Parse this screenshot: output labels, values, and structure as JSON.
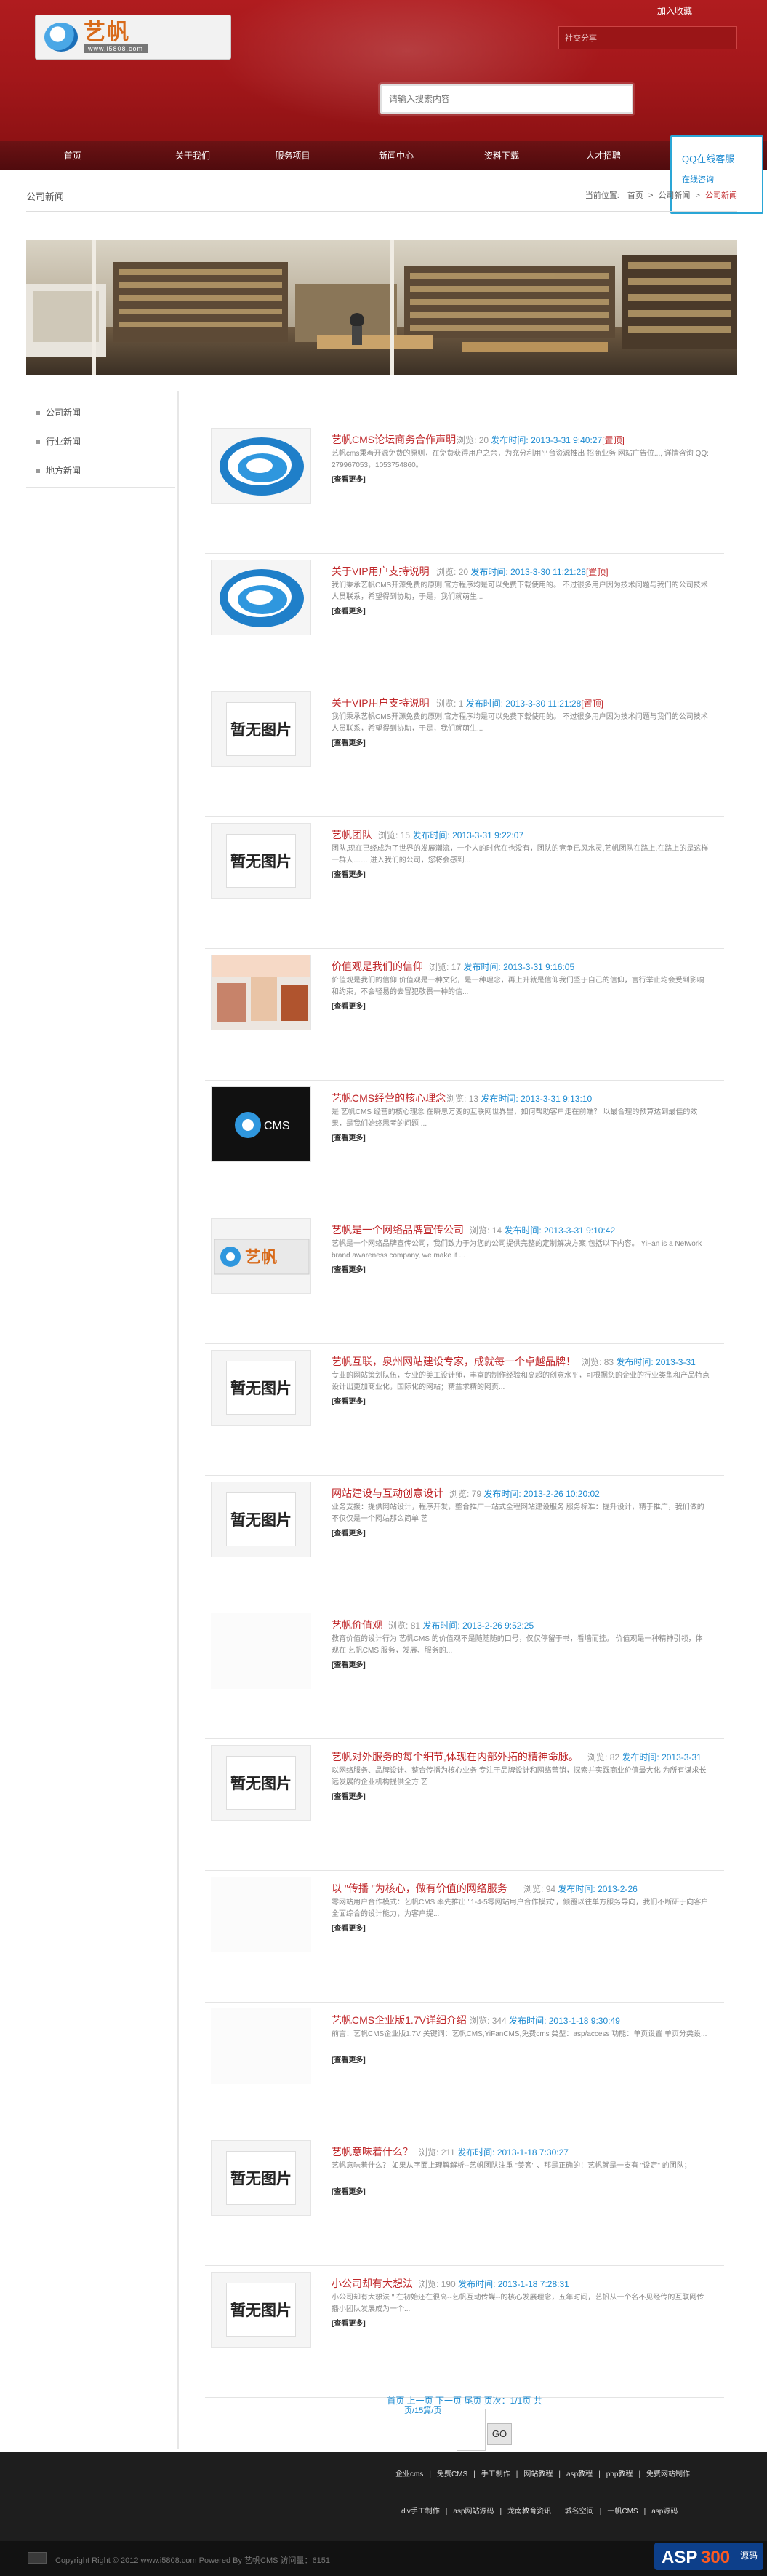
{
  "header": {
    "logo_cn": "艺帆",
    "logo_en": "www.i5808.com",
    "favorite": "加入收藏",
    "share": "社交分享",
    "search_placeholder": "请输入搜索内容"
  },
  "nav": [
    "首页",
    "关于我们",
    "服务项目",
    "新闻中心",
    "资料下载",
    "人才招聘"
  ],
  "qq": {
    "title": "QQ在线客服",
    "sub": "在线咨询"
  },
  "page": {
    "section": "公司新闻",
    "crumb_label": "当前位置:",
    "crumbs": [
      "首页",
      "公司新闻",
      "公司新闻"
    ]
  },
  "sidebar": [
    "公司新闻",
    "行业新闻",
    "地方新闻"
  ],
  "list": [
    {
      "title": "艺帆CMS论坛商务合作声明",
      "views": "20",
      "time": "2013-3-31 9:40:27",
      "top": "[置顶]",
      "desc": "艺帆cms秉着开源免费的原则，在免费获得用户之余，为充分利用平台资源推出 招商业务 网站广告位..., 详情咨询 QQ: 279967053，1053754860。",
      "thumb": "logo"
    },
    {
      "title": "关于VIP用户支持说明",
      "views": "20",
      "time": "2013-3-30 11:21:28",
      "top": "[置顶]",
      "desc": "我们秉承艺帆CMS开源免费的原则,官方程序均是可以免费下载使用的。 不过很多用户因为技术问题与我们的公司技术人员联系，希望得到协助，于是，我们就萌生...",
      "thumb": "logo"
    },
    {
      "title": "关于VIP用户支持说明",
      "views": "1",
      "time": "2013-3-30 11:21:28",
      "top": "[置顶]",
      "desc": "我们秉承艺帆CMS开源免费的原则,官方程序均是可以免费下载使用的。 不过很多用户因为技术问题与我们的公司技术人员联系，希望得到协助，于是，我们就萌生...",
      "thumb": "none"
    },
    {
      "title": "艺帆团队",
      "views": "15",
      "time": "2013-3-31 9:22:07",
      "top": "",
      "desc": "团队,现在已经成为了世界的发展潮流，一个人的时代在也没有，团队的竞争已风水灵,艺帆团队在路上,在路上的是这样一群人…… 进入我们的公司，您将会感到...",
      "thumb": "none"
    },
    {
      "title": "价值观是我们的信仰",
      "views": "17",
      "time": "2013-3-31 9:16:05",
      "top": "",
      "desc": "价值观是我们的信仰 价值观是一种文化，是一种理念，再上升就是信仰我们坚于自己的信仰，言行举止均会受到影响和约束，不会轻易的去冒犯敬畏一种的信...",
      "thumb": "photo"
    },
    {
      "title": "艺帆CMS经营的核心理念",
      "views": "13",
      "time": "2013-3-31 9:13:10",
      "top": "",
      "desc": "是 艺帆CMS 经营的核心理念 在瞬息万变的互联网世界里，如何帮助客户走在前端？ 以最合理的预算达到最佳的效果，是我们始终思考的问题 ...",
      "thumb": "dark"
    },
    {
      "title": "艺帆是一个网络品牌宣传公司",
      "views": "14",
      "time": "2013-3-31 9:10:42",
      "top": "",
      "desc": "艺帆是一个网络品牌宣传公司，我们致力于为您的公司提供完整的定制解决方案,包括以下内容。 YiFan is a Network brand awareness company, we make it ...",
      "thumb": "brand"
    },
    {
      "title": "艺帆互联，泉州网站建设专家，成就每一个卓越品牌！",
      "views": "83",
      "time": "2013-3-31",
      "top": "",
      "desc": "专业的网站策划队伍，专业的美工设计师，丰富的制作经验和高超的创意水平，可根据您的企业的行业类型和产品特点设计出更加商业化，国际化的网站；精益求精的网页...",
      "thumb": "none"
    },
    {
      "title": "网站建设与互动创意设计",
      "views": "79",
      "time": "2013-2-26 10:20:02",
      "top": "",
      "desc": "业务支援：提供网站设计，程序开发，整合推广一站式全程网站建设服务 服务标准：提升设计，精于推广，我们做的不仅仅是一个网站那么简单 艺",
      "thumb": "none"
    },
    {
      "title": "艺帆价值观",
      "views": "81",
      "time": "2013-2-26 9:52:25",
      "top": "",
      "desc": "教育价值的设计行为 艺帆CMS 的价值观不是随随随的口号，仅仅停留于书，看墙而挂。 价值观是一种精神引领，体现在 艺帆CMS 服务，发展、服务的...",
      "thumb": "grey"
    },
    {
      "title": "艺帆对外服务的每个细节,体现在内部外拓的精神命脉。",
      "views": "82",
      "time": "2013-3-31",
      "top": "",
      "desc": "以网络服务、品牌设计、整合传播为核心业务 专注于品牌设计和网络营销，探索并实践商业价值最大化 为所有谋求长远发展的企业机构提供全方 艺",
      "thumb": "none"
    },
    {
      "title": "以 \"传播 \"为核心，做有价值的网络服务",
      "views": "94",
      "time": "2013-2-26",
      "top": "",
      "desc": "零网站用户合作模式：艺帆CMS 率先推出 \"1-4-5零网站用户合作模式\"，倾覆以往单方服务导向，我们不断研于向客户全面综合的设计能力，为客户提...",
      "thumb": "blank"
    },
    {
      "title": "艺帆CMS企业版1.7V详细介绍",
      "views": "344",
      "time": "2013-1-18 9:30:49",
      "top": "",
      "desc": "前言：艺帆CMS企业版1.7V 关键词：艺帆CMS,YiFanCMS,免费cms 类型：asp/access 功能：单页设置 单页分类设...",
      "thumb": "blank"
    },
    {
      "title": "艺帆意味着什么？",
      "views": "211",
      "time": "2013-1-18 7:30:27",
      "top": "",
      "desc": "艺帆意味着什么？ 如果从字面上理解解析--艺帆团队注重 \"美客\" 、那是正确的！艺帆就是一支有 \"设定\" 的团队；",
      "thumb": "none"
    },
    {
      "title": "小公司却有大想法",
      "views": "190",
      "time": "2013-1-18 7:28:31",
      "top": "",
      "desc": "小公司却有大想法 \" 在初始还在很高--艺帆互动传媒--的核心发展理念，五年时间，艺帆从一个名不见经传的互联网传播小团队发展成为一个...",
      "thumb": "none"
    }
  ],
  "labels": {
    "views": "浏览:",
    "time": "发布时间:",
    "more": "[查看更多]",
    "noimg": "暂无图片"
  },
  "pager": {
    "text": "首页 上一页 下一页 尾页 页次：1/1页 共",
    "jump": "页/15篇/页",
    "go": "GO"
  },
  "footer": {
    "links": [
      "企业cms",
      "免费CMS",
      "手工制作",
      "网站教程",
      "asp教程",
      "php教程",
      "免费网站制作"
    ],
    "links2": [
      "div手工制作",
      "asp网站源码",
      "龙南教育资讯",
      "城名空间",
      "一帆CMS",
      "asp源码"
    ],
    "copyright": "Copyright Right © 2012 www.i5808.com Powered By 艺帆CMS 访问量：6151"
  }
}
